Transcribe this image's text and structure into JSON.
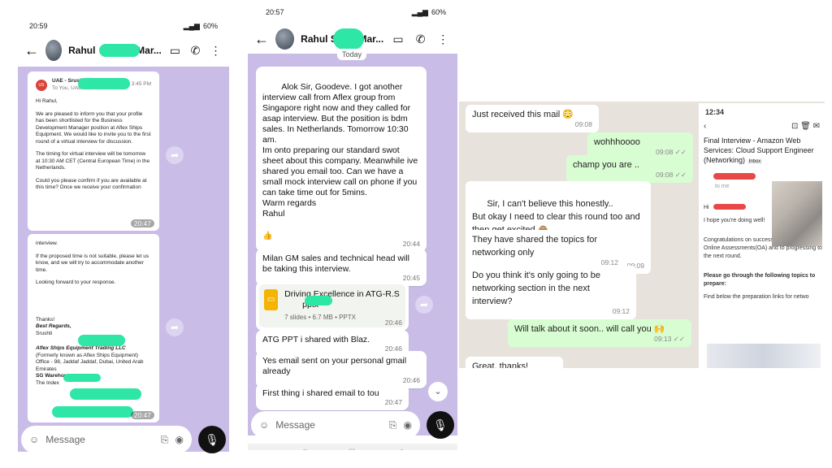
{
  "phone1": {
    "status": {
      "time": "20:59",
      "battery": "60%"
    },
    "contact_name": "Rahul",
    "contact_tail": "Mar...",
    "email": {
      "sender": "UAE - Srushti",
      "recipient": "To You, UAE",
      "sent_time": "3:45 PM",
      "greeting": "Hi Rahul,",
      "para1": "We are pleased to inform you that your profile has been shortlisted for the Business Development Manager position at Aflex Ships Equipment. We would like to invite you to the first round of a virtual interview for discussion.",
      "para2": "The timing for virtual interview will be tomorrow at 10:30 AM CET (Central European Time) in the Netherlands.",
      "para3": "Could you please confirm if you are available at this time? Once we receive your confirmation",
      "time1": "20:47",
      "cont1": "interview.",
      "para4": "If the proposed time is not suitable, please let us know, and we will try to accommodate another time.",
      "para5": "Looking forward to your response.",
      "thanks": "Thanks!",
      "regards": "Best Regards,",
      "signer": "Srushti",
      "company": "Aflex Ships Equipment Trading LLC",
      "formerly": "(Formerly known as Aflex Ships Equipment)",
      "office": "Office - 98, Jaddaf",
      "office_tail": "Jaddaf, Dubai, United Arab Emirates",
      "warehouse": "SG Warehouse",
      "index": "The Index",
      "time2": "20:47"
    },
    "composer_placeholder": "Message"
  },
  "phone2": {
    "status": {
      "time": "20:57",
      "battery": "60%"
    },
    "contact_name": "Rahul S",
    "contact_tail": "Mar...",
    "day_label": "Today",
    "messages": [
      {
        "text": "Alok Sir, Goodeve. I got another interview call from Aflex group from Singapore right now and they called for asap interview. But the position is bdm sales. In Netherlands. Tomorrow 10:30 am.\nIm onto preparing our standard swot sheet about this company. Meanwhile ive shared you email too. Can we have a small mock interview call on phone if you can take time out for 5mins.\nWarm regards\nRahul",
        "time": "20:44"
      },
      {
        "text": "Milan GM sales and technical head will be taking this interview.",
        "time": "20:45"
      },
      {
        "text": "ATG PPT i shared with Blaz.",
        "time": "20:46"
      },
      {
        "text": "Yes email sent on your personal gmail already",
        "time": "20:46"
      },
      {
        "text": "First thing i shared email to tou",
        "time": "20:47"
      }
    ],
    "reaction": "👍",
    "file": {
      "title": "Driving Excellence in ATG-R.S",
      "ext": "pptx",
      "meta": "7 slides • 6.7 MB • PPTX",
      "time": "20:46"
    },
    "composer_placeholder": "Message"
  },
  "shot3": {
    "messages": [
      {
        "text": "Just received this mail 😳",
        "time": "09:08",
        "dir": "in"
      },
      {
        "text": "wohhhoooo",
        "time": "09:08 ✓✓",
        "dir": "out"
      },
      {
        "text": "champ you are ..",
        "time": "09:08 ✓✓",
        "dir": "out"
      },
      {
        "text": "Sir, I can't believe this honestly..\nBut okay I need to clear this round too and then get excited 🙈",
        "time": "Edited 09:09",
        "dir": "in"
      },
      {
        "text": "They have shared the topics for networking only",
        "time": "09:12",
        "dir": "in"
      },
      {
        "text": "Do you think it's only going to be networking section in the next interview?",
        "time": "09:12",
        "dir": "in"
      },
      {
        "text": "Will talk about it soon.. will call you 🙌",
        "time": "09:13 ✓✓",
        "dir": "out"
      },
      {
        "text": "Great, thanks!",
        "time": "",
        "dir": "in"
      }
    ],
    "overlay": {
      "time": "12:34",
      "subject": "Final Interview - Amazon Web Services: Cloud Support Engineer (Networking)",
      "inbox": "Inbox",
      "to": "to me",
      "hi": "Hi",
      "line1": "I hope you're doing well!",
      "line2": "Congratulations on successful completion of Online Assessments(OA) and to progressing to the next round.",
      "line3": "Please go through the following topics to prepare:",
      "line4": "Find below the preparation links for netwo"
    }
  },
  "colors": {
    "chat_bg": "#c9bde8",
    "redaction": "#2ee6a6",
    "out_bubble": "#d9fdd3"
  }
}
